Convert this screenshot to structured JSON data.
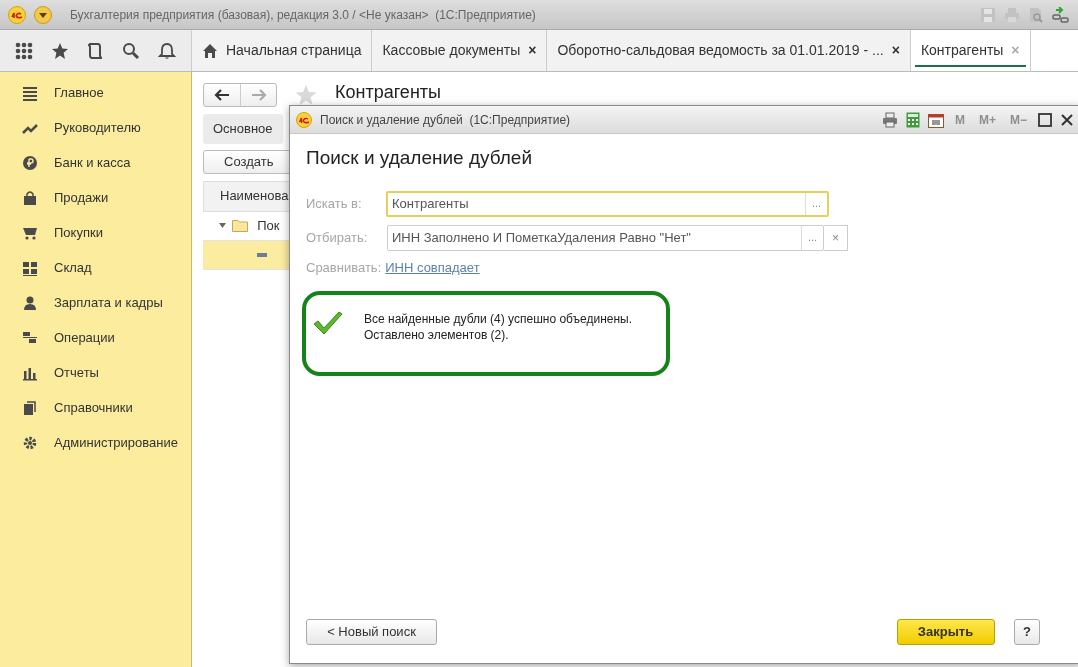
{
  "window": {
    "title": "Бухгалтерия предприятия (базовая), редакция 3.0 / <Не указан>  (1С:Предприятие)"
  },
  "tabs": [
    {
      "label": "Начальная страница",
      "kind": "home",
      "selected": false
    },
    {
      "label": "Кассовые документы",
      "kind": "doc",
      "close": "×",
      "selected": false
    },
    {
      "label": "Оборотно-сальдовая ведомость за 01.01.2019 - ...",
      "kind": "doc",
      "close": "×",
      "selected": false
    },
    {
      "label": "Контрагенты",
      "kind": "doc",
      "close": "×",
      "selected": true
    }
  ],
  "sidebar": {
    "items": [
      {
        "label": "Главное"
      },
      {
        "label": "Руководителю"
      },
      {
        "label": "Банк и касса"
      },
      {
        "label": "Продажи"
      },
      {
        "label": "Покупки"
      },
      {
        "label": "Склад"
      },
      {
        "label": "Зарплата и кадры"
      },
      {
        "label": "Операции"
      },
      {
        "label": "Отчеты"
      },
      {
        "label": "Справочники"
      },
      {
        "label": "Администрирование"
      }
    ]
  },
  "page": {
    "title": "Контрагенты",
    "section_button": "Основное",
    "create_button": "Создать",
    "table": {
      "columns": [
        "Наименова"
      ],
      "rows": [
        {
          "kind": "folder",
          "label": "Пок",
          "expanded": true,
          "selected": false
        },
        {
          "kind": "item",
          "selected": true
        }
      ]
    }
  },
  "dialog": {
    "title": "Поиск и удаление дублей  (1С:Предприятие)",
    "toolbar": [
      {
        "label": "M",
        "disabled": true
      },
      {
        "label": "M+",
        "disabled": true
      },
      {
        "label": "M−",
        "disabled": true
      }
    ],
    "heading": "Поиск и удаление дублей",
    "fields": [
      {
        "label": "Искать в:",
        "value": "Контрагенты",
        "choice": "...",
        "focused": true
      },
      {
        "label": "Отбирать:",
        "value": "ИНН Заполнено И ПометкаУдаления Равно \"Нет\"",
        "choice": "...",
        "clear": "×",
        "focused": false
      }
    ],
    "compare": {
      "label": "Сравнивать:",
      "link": "ИНН совпадает"
    },
    "message": {
      "lines": [
        "Все найденные дубли (4) успешно объединены.",
        "Оставлено элементов (2)."
      ]
    },
    "buttons": {
      "back": "< Новый поиск",
      "close": "Закрыть",
      "help": "?"
    }
  }
}
